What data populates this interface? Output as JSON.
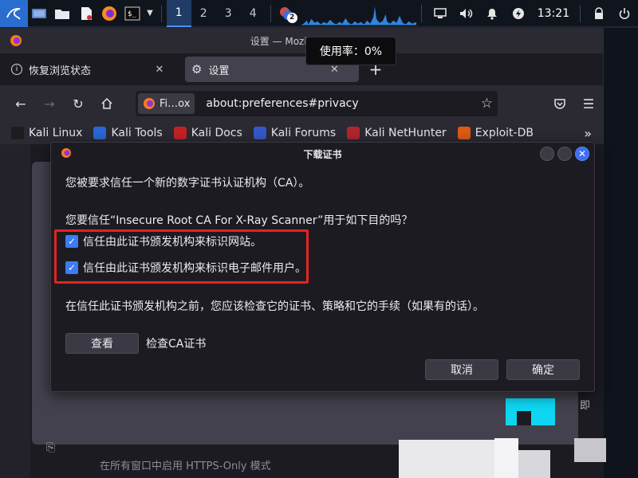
{
  "taskbar": {
    "workspaces": [
      "1",
      "2",
      "3",
      "4"
    ],
    "active_workspace": 0,
    "notification_badge": "2",
    "clock": "13:21"
  },
  "tooltip": {
    "text": "使用率：0%"
  },
  "firefox": {
    "window_title": "设置 — Mozilla Firefox",
    "tabs": [
      {
        "label": "恢复浏览状态",
        "close": "✕"
      },
      {
        "label": "设置",
        "close": "✕"
      }
    ],
    "new_tab": "+",
    "urlbar": {
      "identity_label": "Fi…ox",
      "url": "about:preferences#privacy"
    },
    "bookmarks": [
      {
        "label": "Kali Linux",
        "color": "#1d1d1f"
      },
      {
        "label": "Kali Tools",
        "color": "#2868d4"
      },
      {
        "label": "Kali Docs",
        "color": "#c42126"
      },
      {
        "label": "Kali Forums",
        "color": "#3559c7"
      },
      {
        "label": "Kali NetHunter",
        "color": "#b3262e"
      },
      {
        "label": "Exploit-DB",
        "color": "#e05a16"
      }
    ],
    "bookmarks_overflow": "»"
  },
  "page": {
    "side_text": "即",
    "footer_text": "在所有窗口中启用 HTTPS-Only 模式"
  },
  "dialog": {
    "title": "下载证书",
    "intro": "您被要求信任一个新的数字证书认证机构（CA）。",
    "question": "您要信任“Insecure Root CA For X-Ray Scanner”用于如下目的吗？",
    "options": [
      {
        "label": "信任由此证书颁发机构来标识网站。",
        "checked": true
      },
      {
        "label": "信任由此证书颁发机构来标识电子邮件用户。",
        "checked": true
      }
    ],
    "warning": "在信任此证书颁发机构之前，您应该检查它的证书、策略和它的手续（如果有的话）。",
    "view_button": "查看",
    "view_label": "检查CA证书",
    "cancel_button": "取消",
    "ok_button": "确定"
  },
  "colors": {
    "highlight_box": "#e4231f",
    "accent_blue": "#3d7bf5",
    "cyan_block": "#0ed6f2"
  }
}
